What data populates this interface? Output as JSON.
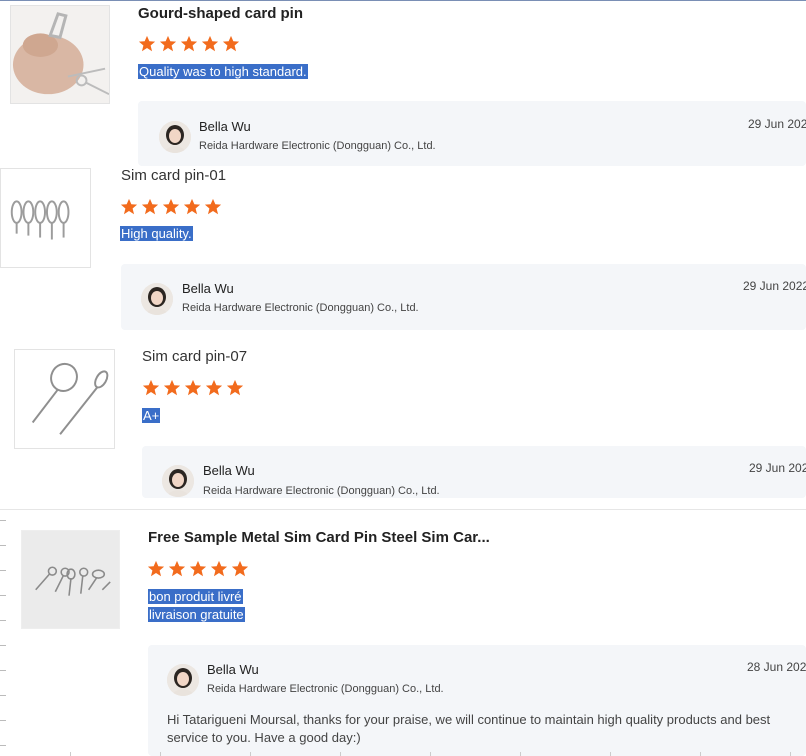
{
  "reviews": [
    {
      "product_title": "Gourd-shaped card pin",
      "rating": 5,
      "comment": "Quality was to high standard.",
      "reply": {
        "name": "Bella Wu",
        "company": "Reida Hardware Electronic (Dongguan) Co., Ltd.",
        "date": "29 Jun 202"
      }
    },
    {
      "product_title": "Sim card pin-01",
      "rating": 5,
      "comment": "High quality.",
      "reply": {
        "name": "Bella Wu",
        "company": "Reida Hardware Electronic (Dongguan) Co., Ltd.",
        "date": "29 Jun 2022"
      }
    },
    {
      "product_title": "Sim card pin-07",
      "rating": 5,
      "comment": "A+",
      "reply": {
        "name": "Bella Wu",
        "company": "Reida Hardware Electronic (Dongguan) Co., Ltd.",
        "date": "29 Jun 202"
      }
    },
    {
      "product_title": "Free Sample Metal Sim Card Pin Steel Sim Car...",
      "rating": 5,
      "comment_lines": [
        "bon produit livré",
        "livraison gratuite"
      ],
      "reply": {
        "name": "Bella Wu",
        "company": "Reida Hardware Electronic (Dongguan) Co., Ltd.",
        "date": "28 Jun 202",
        "message": "Hi Tatarigueni Moursal, thanks for your praise, we will continue to maintain high quality products and best service to you. Have a good day:)"
      }
    }
  ],
  "colors": {
    "star": "#f26b1d",
    "highlight": "#3a6ec8",
    "reply_bg": "#f4f6f9"
  },
  "icons": {
    "star": "star-icon",
    "avatar": "avatar"
  }
}
